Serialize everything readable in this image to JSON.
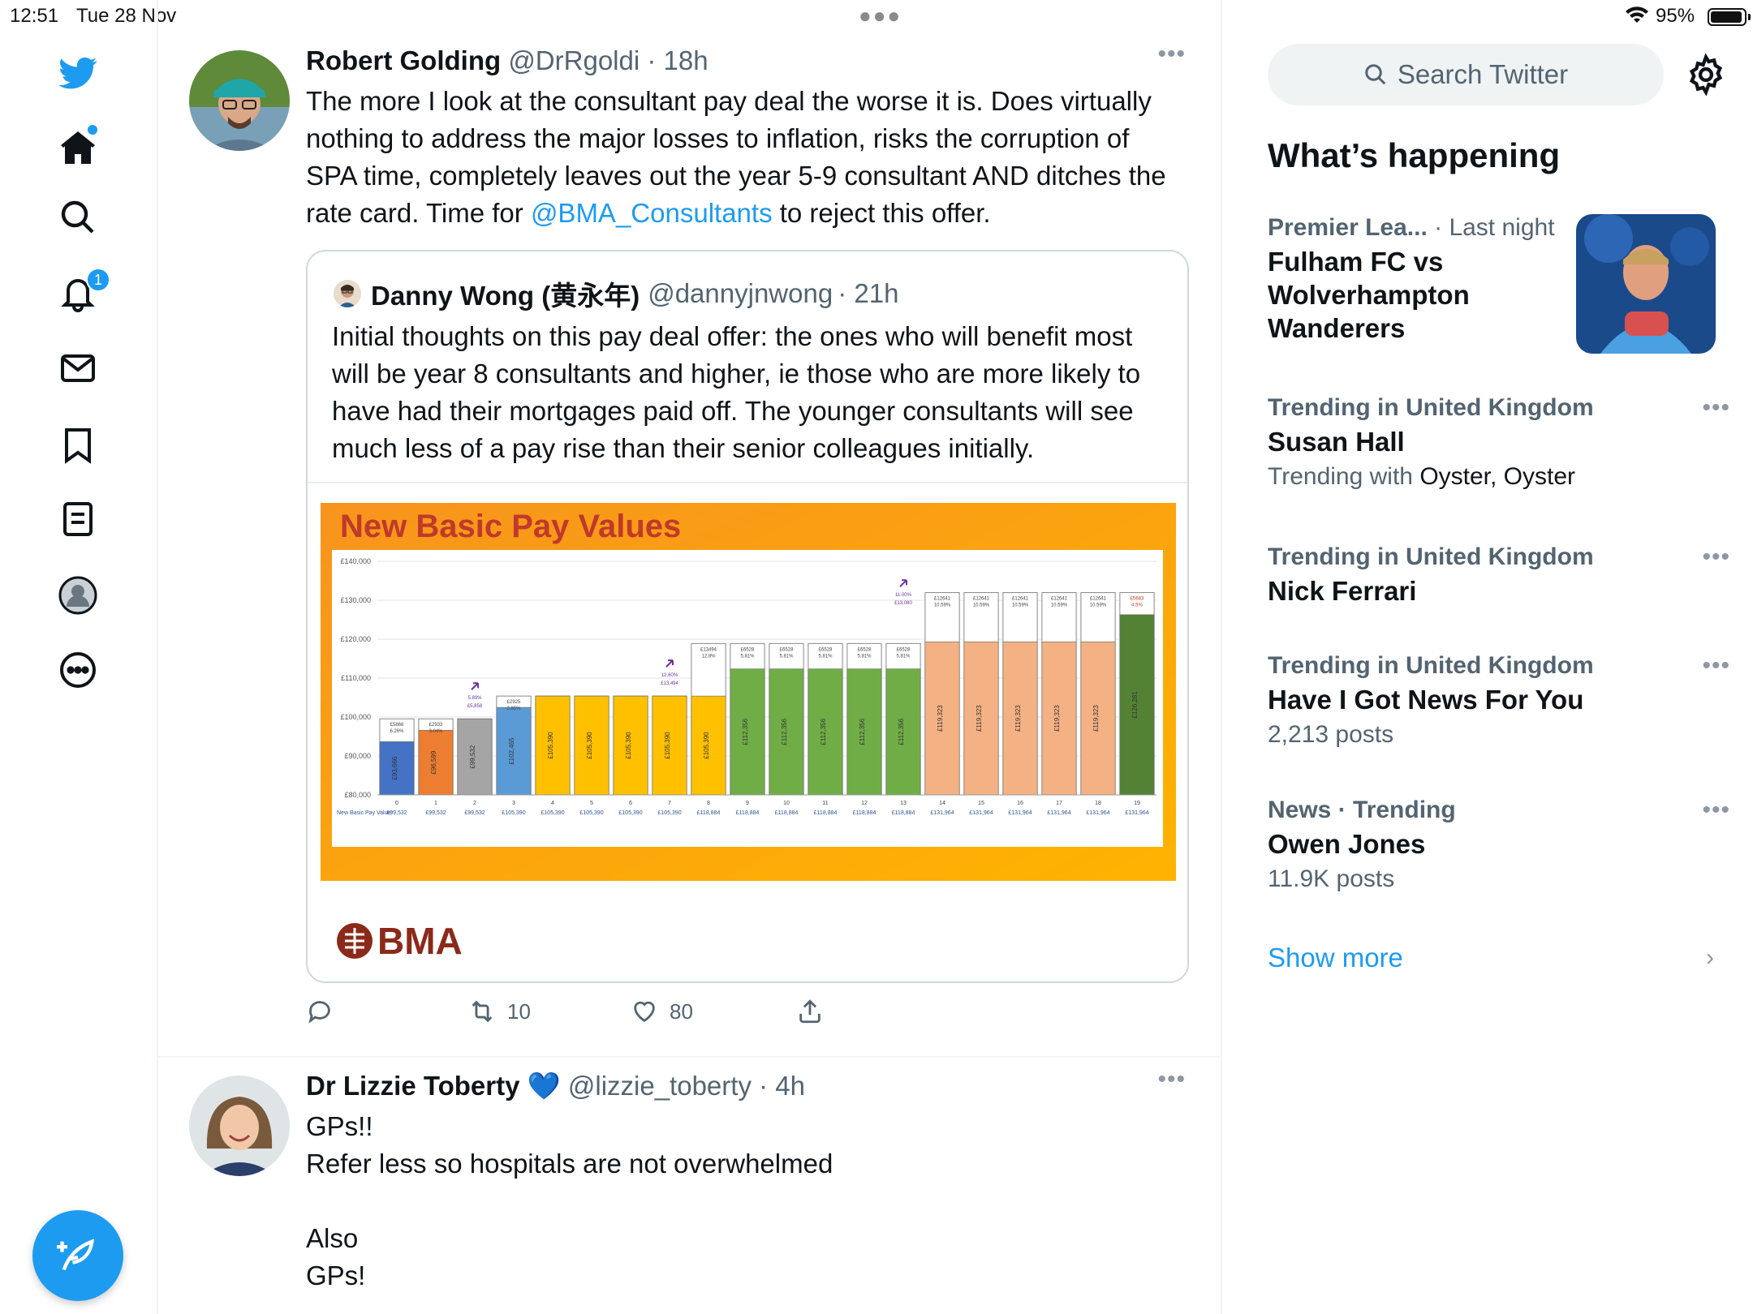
{
  "status_bar": {
    "time": "12:51",
    "date": "Tue 28 Nov",
    "battery": "95%"
  },
  "nav": {
    "notifications_badge": "1",
    "items": [
      "home",
      "explore",
      "notifications",
      "messages",
      "bookmarks",
      "lists",
      "profile",
      "more"
    ]
  },
  "tweets": [
    {
      "name": "Robert Golding",
      "handle": "@DrRgoldi",
      "time": "· 18h",
      "text_before": "The more I look at the consultant pay deal the worse it is. Does virtually nothing to address the major losses to inflation, risks the corruption of SPA time, completely leaves out the year 5-9 consultant AND ditches the rate card. Time for ",
      "mention": "@BMA_Consultants",
      "text_after": " to reject this offer.",
      "quote": {
        "name": "Danny Wong (黄永年)",
        "handle": "@dannyjnwong",
        "time": "· 21h",
        "text": "Initial thoughts on this pay deal offer: the ones who will benefit most will be year 8 consultants and higher, ie those who are more likely to have had their mortgages paid off. The younger consultants will see much less of a pay rise than their senior colleagues initially."
      },
      "retweets": "10",
      "likes": "80"
    },
    {
      "name": "Dr Lizzie Toberty",
      "emoji": "💙",
      "handle": "@lizzie_toberty",
      "time": "· 4h",
      "lines": [
        "GPs!!",
        "Refer less so hospitals are not overwhelmed",
        "",
        "Also",
        "GPs!"
      ]
    }
  ],
  "chart_slide": {
    "title": "New Basic Pay Values",
    "logo_text": "BMA",
    "chart_data": {
      "type": "bar",
      "xlabel": "",
      "ylabel": "",
      "ylim": [
        80000,
        140000
      ],
      "y_ticks": [
        "£80,000",
        "£90,000",
        "£100,000",
        "£110,000",
        "£120,000",
        "£130,000",
        "£140,000"
      ],
      "row_label": "New Basic Pay Value:",
      "categories": [
        "0",
        "1",
        "2",
        "3",
        "4",
        "5",
        "6",
        "7",
        "8",
        "9",
        "10",
        "11",
        "12",
        "13",
        "14",
        "15",
        "16",
        "17",
        "18",
        "19"
      ],
      "series": [
        {
          "values": [
            93666,
            96599,
            99532,
            102465,
            105390,
            105390,
            105390,
            105390,
            105390,
            112356,
            112356,
            112356,
            112356,
            112356,
            119323,
            119323,
            119323,
            119323,
            119323,
            126281
          ]
        },
        {
          "values": [
            99532,
            99532,
            99532,
            105390,
            105390,
            105390,
            105390,
            105390,
            118884,
            118884,
            118884,
            118884,
            118884,
            118884,
            131964,
            131964,
            131964,
            131964,
            131964,
            131964
          ]
        }
      ],
      "bar_labels": [
        "£93,666",
        "£96,599",
        "£99,532",
        "£102,465",
        "£105,390",
        "£105,390",
        "£105,390",
        "£105,390",
        "£105,390",
        "£112,356",
        "£112,356",
        "£112,356",
        "£112,356",
        "£112,356",
        "£119,323",
        "£119,323",
        "£119,323",
        "£119,323",
        "£119,323",
        "£126,281"
      ],
      "new_values": [
        "£99,532",
        "£99,532",
        "£99,532",
        "£105,390",
        "£105,390",
        "£105,390",
        "£105,390",
        "£105,390",
        "£118,884",
        "£118,884",
        "£118,884",
        "£118,884",
        "£118,884",
        "£118,884",
        "£131,964",
        "£131,964",
        "£131,964",
        "£131,964",
        "£131,964",
        "£131,964"
      ],
      "increase_labels": [
        "£5866 6.26%",
        "£2933 3.04%",
        "",
        "£2925 2.85%",
        "",
        "",
        "",
        "",
        "£13494 12.8%",
        "£6528 5.81%",
        "£6528 5.81%",
        "£6528 5.81%",
        "£6528 5.81%",
        "£6528 5.81%",
        "£12641 10.59%",
        "£12641 10.59%",
        "£12641 10.59%",
        "£12641 10.59%",
        "£12641 10.59%",
        "£5683 4.5%"
      ],
      "arrow_labels": [
        {
          "index": 2,
          "text": "5.89% £5,858"
        },
        {
          "index": 7,
          "text": "12.80% £13,494"
        },
        {
          "index": 13,
          "text": "11.00% £13,080"
        }
      ],
      "colors": [
        "#4472c4",
        "#ed7d31",
        "#a5a5a5",
        "#5b9bd5",
        "#ffc000",
        "#ffc000",
        "#ffc000",
        "#ffc000",
        "#ffc000",
        "#70ad47",
        "#70ad47",
        "#70ad47",
        "#70ad47",
        "#70ad47",
        "#f4b183",
        "#f4b183",
        "#f4b183",
        "#f4b183",
        "#f4b183",
        "#548235"
      ]
    }
  },
  "search": {
    "placeholder": "Search Twitter"
  },
  "sidebar": {
    "heading": "What’s happening",
    "trends": [
      {
        "context": "Premier Lea...",
        "context_extra": " · Last night",
        "title_lines": [
          "Fulham FC vs",
          "Wolverhampton",
          "Wanderers"
        ],
        "meta": ""
      },
      {
        "context": "Trending in United Kingdom",
        "title_lines": [
          "Susan Hall"
        ],
        "meta_prefix": "Trending with ",
        "meta_dark": "Oyster, Oyster"
      },
      {
        "context": "Trending in United Kingdom",
        "title_lines": [
          "Nick Ferrari"
        ],
        "meta": ""
      },
      {
        "context": "Trending in United Kingdom",
        "title_lines": [
          "Have I Got News For You"
        ],
        "meta": "2,213 posts"
      },
      {
        "context": "News · Trending",
        "title_lines": [
          "Owen Jones"
        ],
        "meta": "11.9K posts"
      }
    ],
    "show_more": "Show more"
  },
  "colors": {
    "accent": "#1d9bf0",
    "slide_orange": "#f7941d",
    "slide_title": "#c0392b"
  }
}
